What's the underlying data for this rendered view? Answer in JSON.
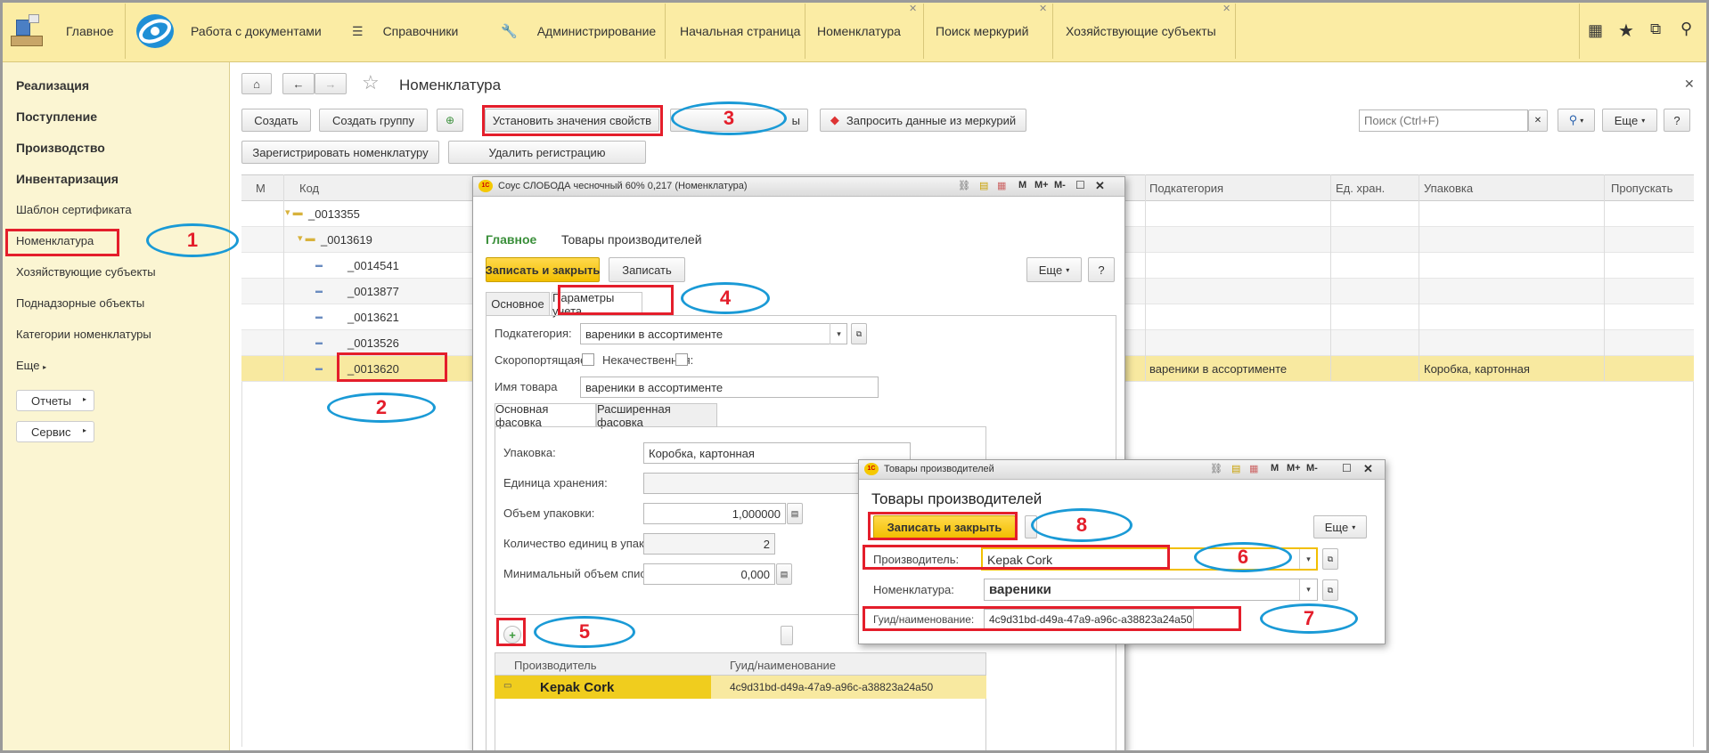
{
  "topbar": {
    "home_label": "Главное",
    "sections": [
      "Работа с документами",
      "Справочники",
      "Администрирование"
    ],
    "tabs": [
      {
        "label": "Начальная страница",
        "closable": false
      },
      {
        "label": "Номенклатура",
        "closable": true
      },
      {
        "label": "Поиск меркурий",
        "closable": true
      },
      {
        "label": "Хозяйствующие субъекты",
        "closable": true
      }
    ]
  },
  "sidebar": {
    "bold_items": [
      "Реализация",
      "Поступление",
      "Производство",
      "Инвентаризация"
    ],
    "items": [
      "Шаблон сертификата",
      "Номенклатура",
      "Хозяйствующие субъекты",
      "Поднадзорные объекты",
      "Категории номенклатуры"
    ],
    "more_label": "Еще",
    "buttons": [
      "Отчеты",
      "Сервис"
    ]
  },
  "page": {
    "title": "Номенклатура",
    "toolbar": {
      "create": "Создать",
      "create_group": "Создать группу",
      "set_props": "Установить значения свойств",
      "set_props_tail": "ы",
      "request_mercury": "Запросить данные из меркурий",
      "search_placeholder": "Поиск (Ctrl+F)",
      "more": "Еще",
      "help": "?",
      "register": "Зарегистрировать номенклатуру",
      "unregister": "Удалить регистрацию"
    },
    "columns": [
      "М",
      "Код",
      "Подкатегория",
      "Ед. хран.",
      "Упаковка",
      "Пропускать"
    ],
    "rows": [
      {
        "code": "_0013355",
        "level": 1,
        "type": "folder",
        "subcategory": "",
        "packaging": ""
      },
      {
        "code": "_0013619",
        "level": 2,
        "type": "folder",
        "subcategory": "",
        "packaging": ""
      },
      {
        "code": "_0014541",
        "level": 3,
        "type": "item",
        "subcategory": "",
        "packaging": ""
      },
      {
        "code": "_0013877",
        "level": 3,
        "type": "item",
        "subcategory": "",
        "packaging": ""
      },
      {
        "code": "_0013621",
        "level": 3,
        "type": "item",
        "subcategory": "",
        "packaging": ""
      },
      {
        "code": "_0013526",
        "level": 3,
        "type": "item",
        "subcategory": "",
        "packaging": ""
      },
      {
        "code": "_0013620",
        "level": 3,
        "type": "item",
        "subcategory": "вареники в ассортименте",
        "packaging": "Коробка, картонная"
      }
    ]
  },
  "item_window": {
    "title": "Соус СЛОБОДА чесночный 60% 0,217 (Номенклатура)",
    "nav": [
      "Главное",
      "Товары производителей"
    ],
    "save_close": "Записать и закрыть",
    "save": "Записать",
    "more": "Еще",
    "help": "?",
    "tabs": [
      "Основное",
      "Параметры учета"
    ],
    "subcategory_label": "Подкатегория:",
    "subcategory_value": "вареники в ассортименте",
    "perishable_label": "Скоропортящаяся:",
    "low_quality_label": "Некачественная:",
    "product_name_label": "Имя товара",
    "product_name_value": "вареники в ассортименте",
    "pack_tabs": [
      "Основная фасовка",
      "Расширенная фасовка"
    ],
    "pack_label": "Упаковка:",
    "pack_value": "Коробка, картонная",
    "unit_label": "Единица хранения:",
    "volume_label": "Объем упаковки:",
    "volume_value": "1,000000",
    "count_label": "Количество единиц в упаковке:",
    "count_value": "2",
    "min_label": "Минимальный объем списания:",
    "min_value": "0,000",
    "grid_headers": [
      "Производитель",
      "Гуид/наименование"
    ],
    "grid_row": {
      "producer": "Kepak Cork",
      "guid": "4c9d31bd-d49a-47a9-a96c-a38823a24a50"
    }
  },
  "producer_window": {
    "title": "Товары производителей",
    "heading": "Товары производителей",
    "save_close": "Записать и закрыть",
    "more": "Еще",
    "producer_label": "Производитель:",
    "producer_value": "Kepak Cork",
    "nomenclature_label": "Номенклатура:",
    "nomenclature_value": "вареники",
    "guid_label": "Гуид/наименование:",
    "guid_value": "4c9d31bd-d49a-47a9-a96c-a38823a24a50"
  },
  "annotations": [
    "1",
    "2",
    "3",
    "4",
    "5",
    "6",
    "7",
    "8"
  ],
  "colors": {
    "accent_yellow": "#fbeca4",
    "button_yellow": "#f5c800",
    "selection": "#f8e9a0",
    "annotation_red": "#e41e2b",
    "annotation_blue": "#1a9ad6",
    "nav_green": "#3a8f3a"
  }
}
